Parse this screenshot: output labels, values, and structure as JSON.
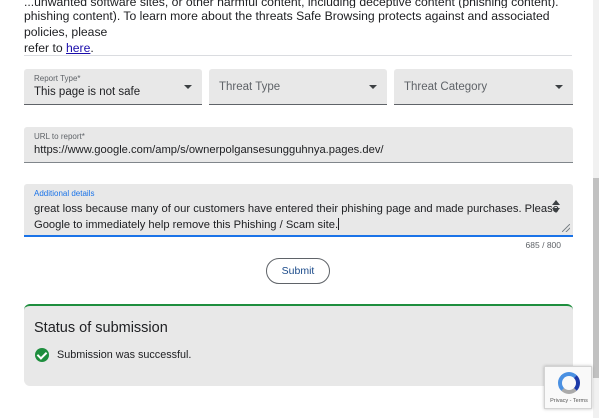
{
  "intro": {
    "cut_text": "...unwanted software sites, or other harmful content, including deceptive content (phishing content).",
    "line1": "phishing content). To learn more about the threats Safe Browsing protects against and associated policies, please",
    "line2_prefix": "refer to ",
    "link": "here",
    "line2_suffix": "."
  },
  "form": {
    "report_type": {
      "label": "Report Type*",
      "value": "This page is not safe"
    },
    "threat_type": {
      "placeholder": "Threat Type"
    },
    "threat_category": {
      "placeholder": "Threat Category"
    },
    "url": {
      "label": "URL to report*",
      "value": "https://www.google.com/amp/s/ownerpolgansesungguhnya.pages.dev/"
    },
    "details": {
      "label": "Additional details",
      "line1": "great loss because many of our customers have entered their phishing page and made purchases. Please",
      "line2": "Google to immediately help remove this Phishing / Scam site."
    },
    "counter": "685 / 800",
    "submit_label": "Submit"
  },
  "status": {
    "title": "Status of submission",
    "message": "Submission was successful."
  },
  "recaptcha": {
    "text": "Privacy - Terms"
  },
  "colors": {
    "success": "#1e8e3e",
    "focus": "#1a73e8",
    "link": "#1a0dab"
  }
}
